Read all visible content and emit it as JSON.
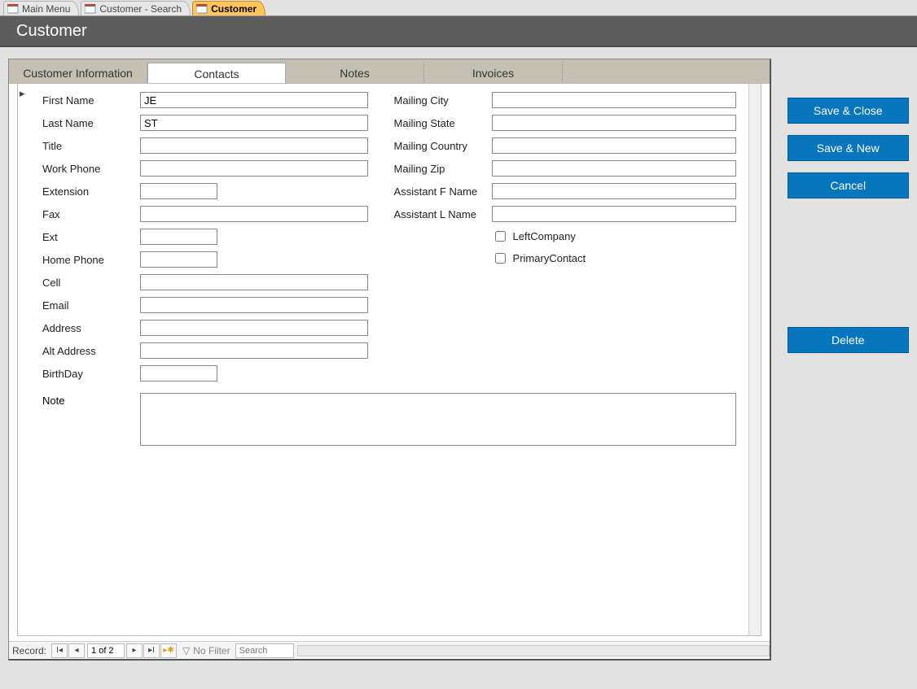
{
  "outerTabs": {
    "t0": "Main Menu",
    "t1": "Customer - Search",
    "t2": "Customer"
  },
  "header": {
    "title": "Customer"
  },
  "innerTabs": {
    "t0": "Customer Information",
    "t1": "Contacts",
    "t2": "Notes",
    "t3": "Invoices"
  },
  "fields": {
    "first_name": {
      "label": "First Name",
      "value": "JE"
    },
    "last_name": {
      "label": "Last Name",
      "value": "ST"
    },
    "title": {
      "label": "Title",
      "value": ""
    },
    "work_phone": {
      "label": "Work Phone",
      "value": ""
    },
    "extension": {
      "label": "Extension",
      "value": ""
    },
    "fax": {
      "label": "Fax",
      "value": ""
    },
    "ext": {
      "label": "Ext",
      "value": ""
    },
    "home_phone": {
      "label": "Home Phone",
      "value": ""
    },
    "cell": {
      "label": "Cell",
      "value": ""
    },
    "email": {
      "label": "Email",
      "value": ""
    },
    "address": {
      "label": "Address",
      "value": ""
    },
    "alt_address": {
      "label": "Alt Address",
      "value": ""
    },
    "birthday": {
      "label": "BirthDay",
      "value": ""
    },
    "mailing_city": {
      "label": "Mailing City",
      "value": ""
    },
    "mailing_state": {
      "label": "Mailing State",
      "value": ""
    },
    "mailing_country": {
      "label": "Mailing Country",
      "value": ""
    },
    "mailing_zip": {
      "label": "Mailing Zip",
      "value": ""
    },
    "assistant_f_name": {
      "label": "Assistant F Name",
      "value": ""
    },
    "assistant_l_name": {
      "label": "Assistant L Name",
      "value": ""
    },
    "left_company": {
      "label": "LeftCompany"
    },
    "primary_contact": {
      "label": "PrimaryContact"
    },
    "note": {
      "label": "Note",
      "value": ""
    }
  },
  "recordNav": {
    "label": "Record:",
    "position": "1 of 2",
    "noFilter": "No Filter",
    "searchPlaceholder": "Search"
  },
  "buttons": {
    "save_close": "Save & Close",
    "save_new": "Save & New",
    "cancel": "Cancel",
    "delete": "Delete"
  }
}
